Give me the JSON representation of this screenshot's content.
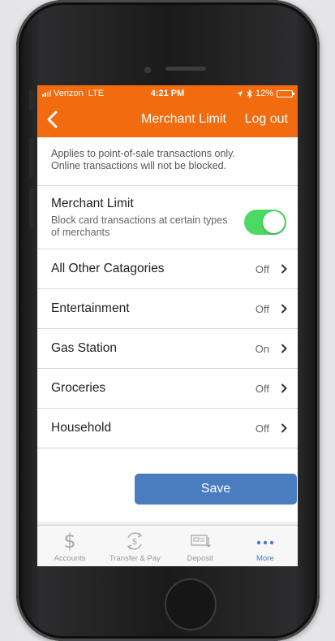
{
  "status_bar": {
    "carrier": "Verizon",
    "network": "LTE",
    "time": "4:21 PM",
    "battery": "12%",
    "battery_level": 0.12
  },
  "nav": {
    "title": "Merchant Limit",
    "logout_label": "Log out"
  },
  "notice": {
    "line1": "Applies to point-of-sale transactions only.",
    "line2": "Online transactions will not be blocked."
  },
  "merchant_limit": {
    "title": "Merchant Limit",
    "description": "Block card transactions at certain types of merchants",
    "enabled": true
  },
  "categories": [
    {
      "name": "All Other Catagories",
      "status": "Off"
    },
    {
      "name": "Entertainment",
      "status": "Off"
    },
    {
      "name": "Gas Station",
      "status": "On"
    },
    {
      "name": "Groceries",
      "status": "Off"
    },
    {
      "name": "Household",
      "status": "Off"
    }
  ],
  "save_label": "Save",
  "tabs": [
    {
      "label": "Accounts",
      "icon": "dollar-icon"
    },
    {
      "label": "Transfer & Pay",
      "icon": "transfer-icon"
    },
    {
      "label": "Deposit",
      "icon": "deposit-check-icon"
    },
    {
      "label": "More",
      "icon": "more-dots-icon",
      "active": true
    }
  ],
  "colors": {
    "brand_orange": "#f26b0f",
    "toggle_on": "#4cd964",
    "save_button": "#4a7dbf",
    "active_tab": "#4a7dbf"
  }
}
